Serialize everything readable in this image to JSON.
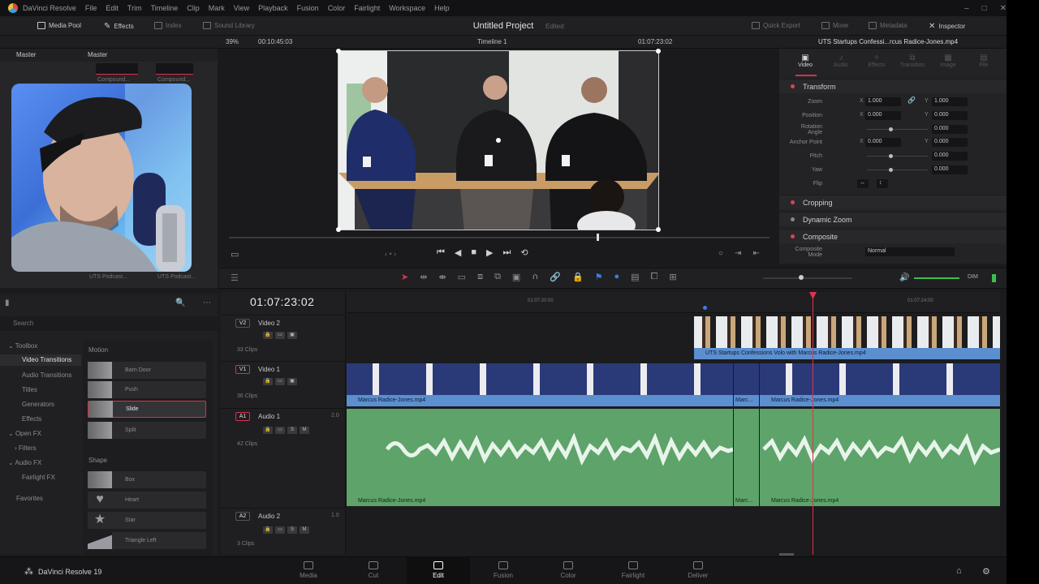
{
  "menubar": {
    "items": [
      "DaVinci Resolve",
      "File",
      "Edit",
      "Trim",
      "Timeline",
      "Clip",
      "Mark",
      "View",
      "Playback",
      "Fusion",
      "Color",
      "Fairlight",
      "Workspace",
      "Help"
    ]
  },
  "toolbar": {
    "media_pool": "Media Pool",
    "effects": "Effects",
    "index": "Index",
    "sound_library": "Sound Library",
    "project_title": "Untitled Project",
    "project_status": "Edited",
    "quick_export": "Quick Export",
    "mixer": "Mixer",
    "metadata": "Metadata",
    "inspector": "Inspector"
  },
  "subbar": {
    "zoom": "39%",
    "source_tc": "00:10:45:03",
    "timeline_name": "Timeline 1",
    "record_tc": "01:07:23:02",
    "clip_name": "UTS Startups Confessi...rcus Radice-Jones.mp4"
  },
  "mediapool": {
    "tab_master": "Master",
    "tab_master2": "Master",
    "thumb_labels": [
      "Compound...",
      "Compound...",
      "UTS Podcast...",
      "UTS Podcast..."
    ]
  },
  "inspector": {
    "tabs": [
      "Video",
      "Audio",
      "Effects",
      "Transition",
      "Image",
      "File"
    ],
    "transform": "Transform",
    "zoom_label": "Zoom",
    "zoom_x": "1.000",
    "zoom_y": "1.000",
    "position_label": "Position",
    "position_x": "0.000",
    "position_y": "0.000",
    "rotation_label": "Rotation Angle",
    "rotation_val": "0.000",
    "anchor_label": "Anchor Point",
    "anchor_x": "0.000",
    "anchor_y": "0.000",
    "pitch_label": "Pitch",
    "pitch_val": "0.000",
    "yaw_label": "Yaw",
    "yaw_val": "0.000",
    "flip_label": "Flip",
    "cropping": "Cropping",
    "dynamic_zoom": "Dynamic Zoom",
    "composite": "Composite",
    "composite_mode_label": "Composite Mode",
    "composite_mode_val": "Normal",
    "x": "X",
    "y": "Y"
  },
  "effects": {
    "search_placeholder": "Search",
    "tree": [
      "Toolbox",
      "Video Transitions",
      "Audio Transitions",
      "Titles",
      "Generators",
      "Effects",
      "Open FX",
      "Filters",
      "Audio FX",
      "Fairlight FX",
      "Favorites"
    ],
    "motion_header": "Motion",
    "motion_items": [
      "Barn Door",
      "Push",
      "Slide",
      "Split"
    ],
    "shape_header": "Shape",
    "shape_items": [
      "Box",
      "Heart",
      "Star",
      "Triangle Left"
    ]
  },
  "timeline": {
    "timecode": "01:07:23:02",
    "ruler": [
      "01:07:20:00",
      "01:07:24:00"
    ],
    "tracks": [
      {
        "id": "V2",
        "name": "Video 2",
        "clips": "33 Clips"
      },
      {
        "id": "V1",
        "name": "Video 1",
        "clips": "36 Clips"
      },
      {
        "id": "A1",
        "name": "Audio 1",
        "clips": "42 Clips",
        "level": "2.0"
      },
      {
        "id": "A2",
        "name": "Audio 2",
        "clips": "3 Clips",
        "level": "1.0"
      }
    ],
    "v2_clip": "UTS Startups Confessions Volo with Marcus Radice-Jones.mp4",
    "v1_clip_a": "Marcus Radice-Jones.mp4",
    "v1_clip_b": "Marc...",
    "v1_clip_c": "Marcus Radice-Jones.mp4",
    "a1_clip_a": "Marcus Radice-Jones.mp4",
    "a1_clip_b": "Marc...",
    "a1_clip_c": "Marcus Radice-Jones.mp4",
    "audio_meter": "DIM"
  },
  "pages": [
    "Media",
    "Cut",
    "Edit",
    "Fusion",
    "Color",
    "Fairlight",
    "Deliver"
  ],
  "active_page": "Edit",
  "brand": "DaVinci Resolve 19",
  "colors": {
    "accent": "#d8314a",
    "video_clip": "#5b8fcf",
    "audio_clip": "#5da36a",
    "playhead": "#e0334a"
  }
}
